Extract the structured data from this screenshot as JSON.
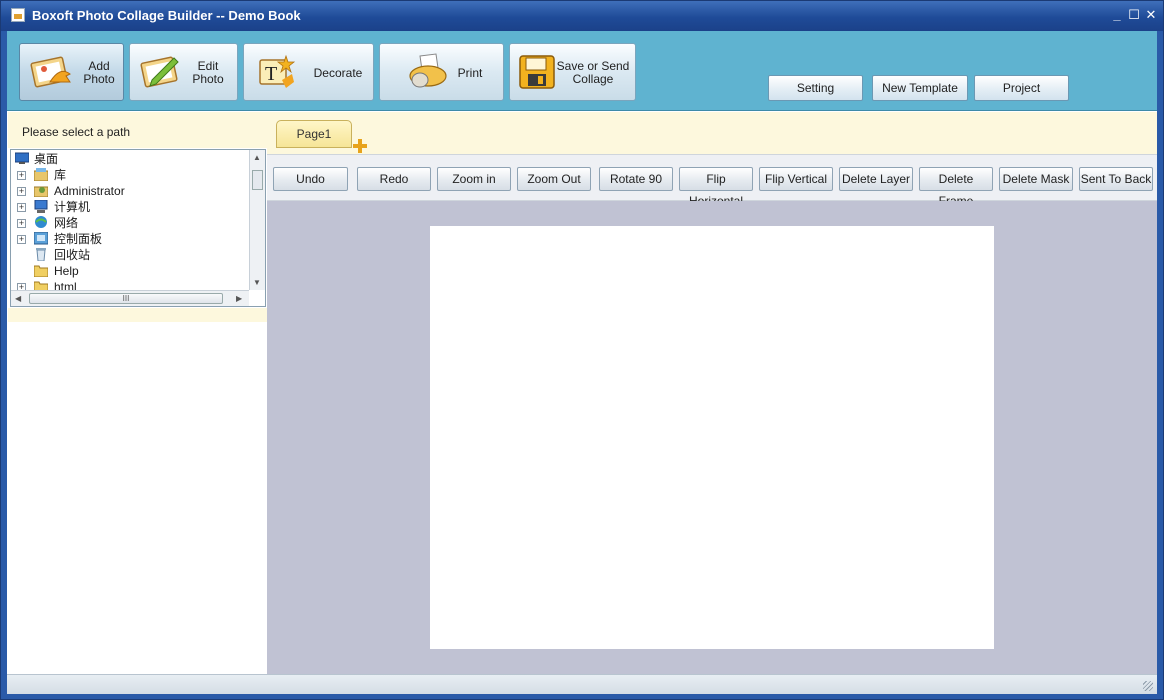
{
  "window": {
    "title": "Boxoft Photo Collage Builder -- Demo Book",
    "controls": {
      "minimize": "_",
      "maximize": "☐",
      "close": "✕"
    }
  },
  "ribbon": {
    "main_buttons": [
      {
        "line1": "Add",
        "line2": "Photo",
        "icon": "add-photo-icon",
        "active": true
      },
      {
        "line1": "Edit",
        "line2": "Photo",
        "icon": "edit-photo-icon"
      },
      {
        "line1": "Decorate",
        "line2": "",
        "icon": "decorate-icon"
      },
      {
        "line1": "Print",
        "line2": "",
        "icon": "print-icon"
      },
      {
        "line1": "Save or Send",
        "line2": "Collage",
        "icon": "save-icon"
      }
    ],
    "right_buttons": [
      "Setting",
      "New Template",
      "Project"
    ]
  },
  "left_panel": {
    "header": "Please select a path",
    "tree": [
      {
        "label": "桌面",
        "icon": "desktop-icon",
        "expander": ""
      },
      {
        "label": "库",
        "icon": "library-icon",
        "expander": "+"
      },
      {
        "label": "Administrator",
        "icon": "user-icon",
        "expander": "+"
      },
      {
        "label": "计算机",
        "icon": "computer-icon",
        "expander": "+"
      },
      {
        "label": "网络",
        "icon": "network-icon",
        "expander": "+"
      },
      {
        "label": "控制面板",
        "icon": "control-panel-icon",
        "expander": "+"
      },
      {
        "label": "回收站",
        "icon": "recycle-bin-icon",
        "expander": ""
      },
      {
        "label": "Help",
        "icon": "folder-icon",
        "expander": ""
      },
      {
        "label": "html",
        "icon": "folder-icon",
        "expander": "+"
      }
    ],
    "hscroll_grip": "III"
  },
  "pages": {
    "tabs": [
      "Page1"
    ]
  },
  "toolbar": {
    "buttons": [
      "Undo",
      "Redo",
      "Zoom in",
      "Zoom Out",
      "Rotate 90",
      "Flip Horizontal",
      "Flip Vertical",
      "Delete Layer",
      "Delete Frame",
      "Delete Mask",
      "Sent To Back"
    ]
  },
  "colors": {
    "ribbon": "#5fb3d0",
    "titlebar": "#1f4b98",
    "panel_cream": "#fdf8dd",
    "canvas_bg": "#c0c2d3",
    "accent_orange": "#e7a31c"
  }
}
